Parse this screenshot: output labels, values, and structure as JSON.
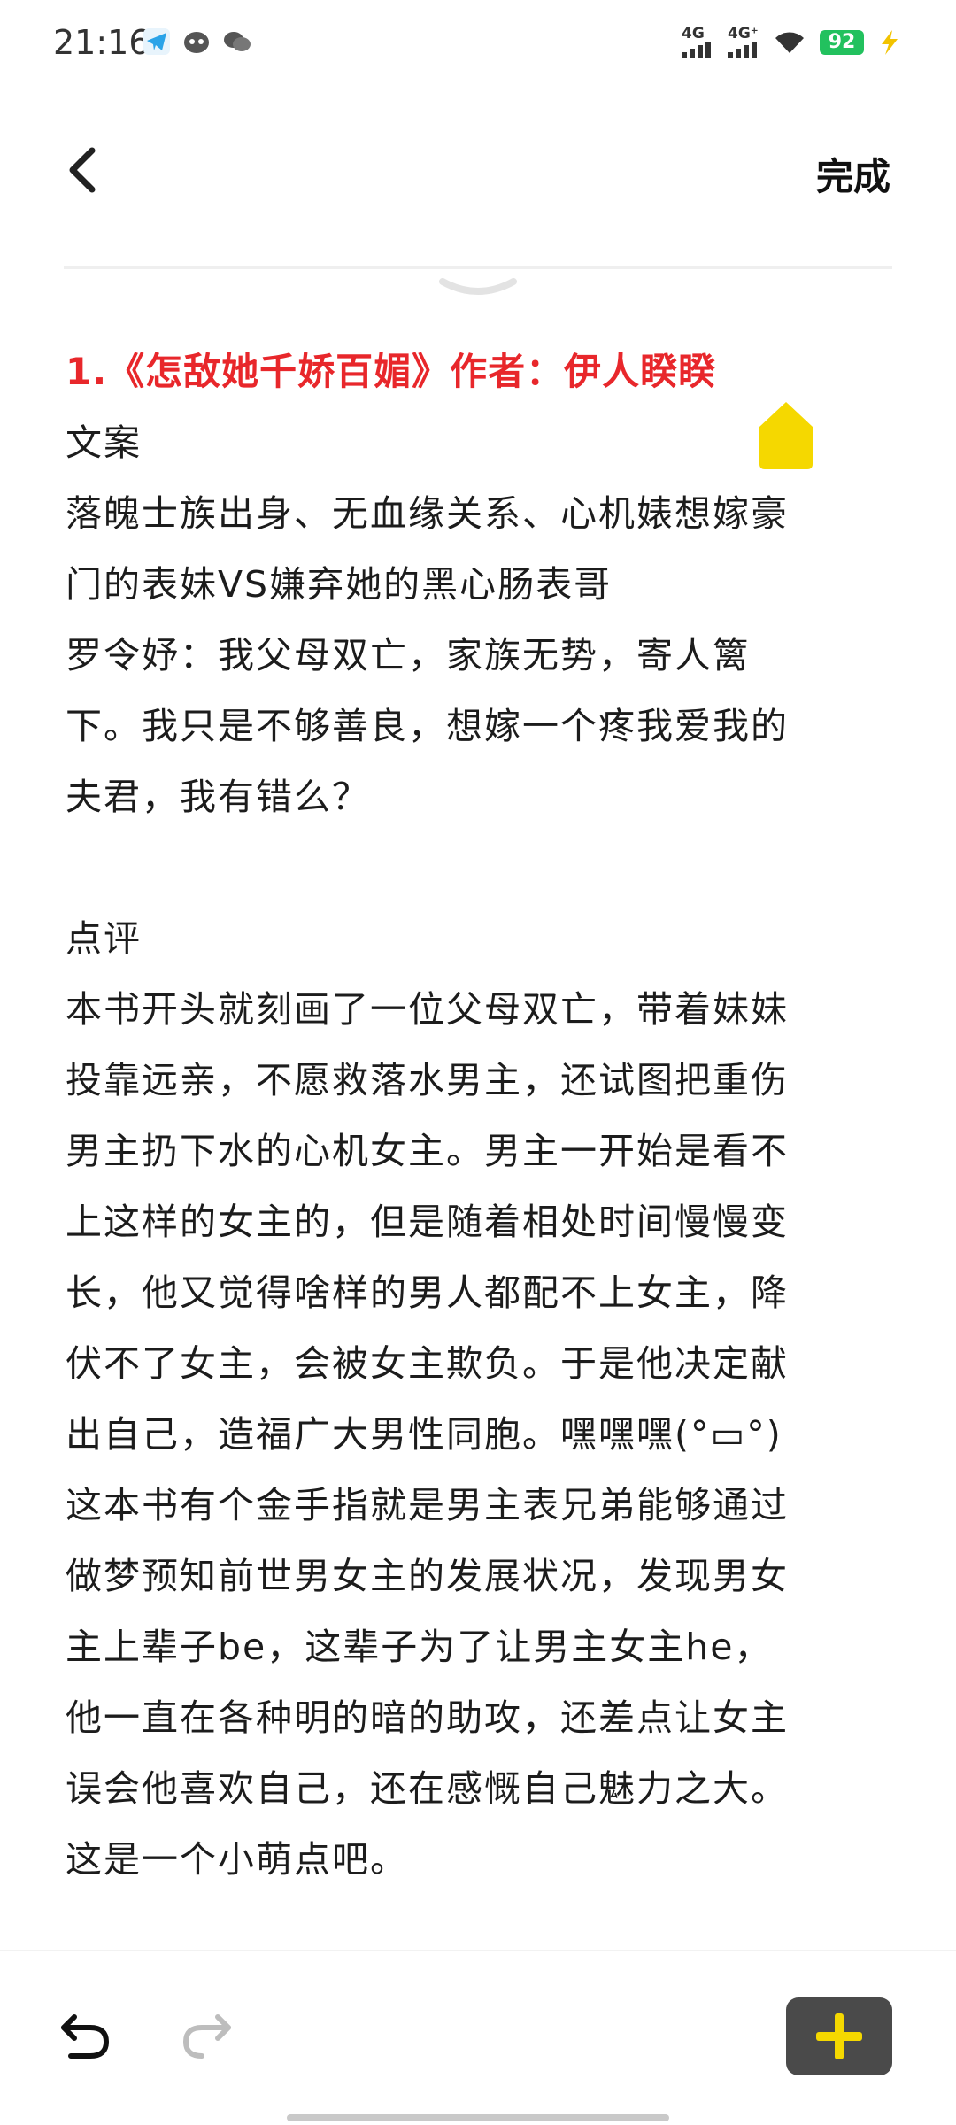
{
  "status_bar": {
    "time": "21:16",
    "left_icons": [
      "telegram-icon",
      "face-app-icon",
      "wechat-icon"
    ],
    "signal_1": "4G",
    "signal_2": "4G⁺",
    "battery_level": "92",
    "battery_color": "#22c15e",
    "right_icons": [
      "signal-icon",
      "signal-icon",
      "wifi-icon",
      "battery-icon",
      "charging-icon"
    ]
  },
  "header": {
    "back_icon": "chevron-left-icon",
    "done_label": "完成"
  },
  "editor": {
    "title": "1.《怎敌她千娇百媚》作者：伊人睽睽",
    "title_color": "#e8272b",
    "lines": [
      "文案",
      "落魄士族出身、无血缘关系、心机婊想嫁豪",
      "门的表妹VS嫌弃她的黑心肠表哥",
      "罗令妤：我父母双亡，家族无势，寄人篱",
      "下。我只是不够善良，想嫁一个疼我爱我的",
      "夫君，我有错么？",
      "",
      "点评",
      "本书开头就刻画了一位父母双亡，带着妹妹",
      "投靠远亲，不愿救落水男主，还试图把重伤",
      "男主扔下水的心机女主。男主一开始是看不",
      "上这样的女主的，但是随着相处时间慢慢变",
      "长，他又觉得啥样的男人都配不上女主，降",
      "伏不了女主，会被女主欺负。于是他决定献",
      "出自己，造福广大男性同胞。嘿嘿嘿(°▭°)",
      "这本书有个金手指就是男主表兄弟能够通过",
      "做梦预知前世男女主的发展状况，发现男女",
      "主上辈子be，这辈子为了让男主女主he，",
      "他一直在各种明的暗的助攻，还差点让女主",
      "误会他喜欢自己，还在感慨自己魅力之大。",
      "这是一个小萌点吧。"
    ]
  },
  "bottom_toolbar": {
    "undo_icon": "undo-icon",
    "redo_icon": "redo-icon",
    "add_icon": "plus-icon",
    "accent": "#f5d800"
  }
}
